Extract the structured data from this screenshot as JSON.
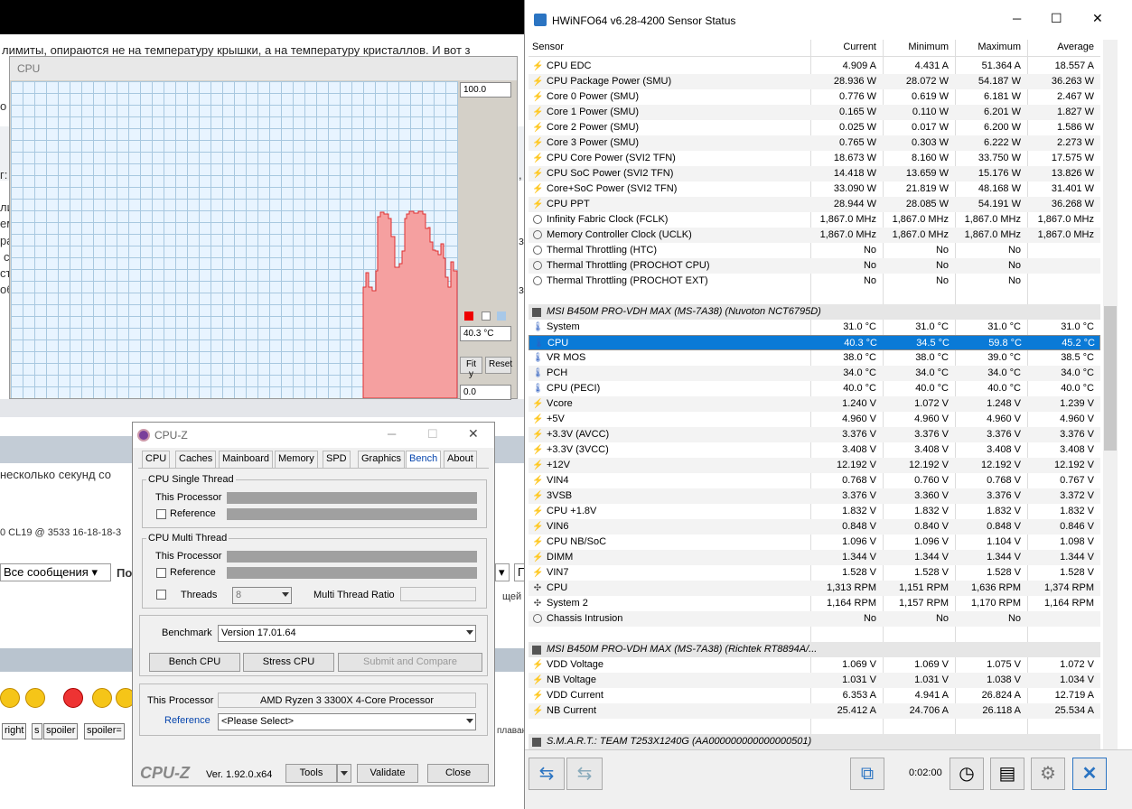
{
  "forum": {
    "line1": "лимиты, опираются не на температуру крышки, а на температуру кристаллов. И вот з",
    "line_few": "несколько секунд со",
    "line_cl": "0 CL19 @ 3533 16-18-18-3",
    "all_messages": "Все сообщения",
    "po": "По",
    "p": "П",
    "shchey": "щей",
    "slavo": "плаваю",
    "tags": [
      "right",
      "s",
      "spoiler",
      "spoiler="
    ],
    "left_fragments": [
      "о с",
      "г:",
      "лия",
      "ем",
      "ра",
      "с",
      "ст",
      "об"
    ],
    "right_fragments": [
      ",",
      "з",
      "з"
    ]
  },
  "graph": {
    "title": "CPU",
    "max": "100.0",
    "current": "40.3 °C",
    "min": "0.0",
    "fit_y": "Fit y",
    "reset": "Reset"
  },
  "cpuz": {
    "title": "CPU-Z",
    "tabs": [
      "CPU",
      "Caches",
      "Mainboard",
      "Memory",
      "SPD",
      "Graphics",
      "Bench",
      "About"
    ],
    "single_thread": "CPU Single Thread",
    "multi_thread": "CPU Multi Thread",
    "this_processor": "This Processor",
    "reference": "Reference",
    "threads": "Threads",
    "threads_value": "8",
    "multi_ratio": "Multi Thread Ratio",
    "benchmark_label": "Benchmark",
    "benchmark_version": "Version 17.01.64",
    "bench_cpu": "Bench CPU",
    "stress_cpu": "Stress CPU",
    "submit": "Submit and Compare",
    "this_processor2": "This Processor",
    "processor_name": "AMD Ryzen 3 3300X 4-Core Processor",
    "reference2": "Reference",
    "please_select": "<Please Select>",
    "logo": "CPU-Z",
    "version": "Ver. 1.92.0.x64",
    "tools": "Tools",
    "validate": "Validate",
    "close": "Close"
  },
  "hwinfo": {
    "title": "HWiNFO64 v6.28-4200 Sensor Status",
    "columns": [
      "Sensor",
      "Current",
      "Minimum",
      "Maximum",
      "Average"
    ],
    "rows1": [
      {
        "icon": "bolt",
        "name": "CPU EDC",
        "cur": "4.909 A",
        "min": "4.431 A",
        "max": "51.364 A",
        "avg": "18.557 A"
      },
      {
        "icon": "bolt",
        "name": "CPU Package Power (SMU)",
        "cur": "28.936 W",
        "min": "28.072 W",
        "max": "54.187 W",
        "avg": "36.263 W"
      },
      {
        "icon": "bolt",
        "name": "Core 0 Power (SMU)",
        "cur": "0.776 W",
        "min": "0.619 W",
        "max": "6.181 W",
        "avg": "2.467 W"
      },
      {
        "icon": "bolt",
        "name": "Core 1 Power (SMU)",
        "cur": "0.165 W",
        "min": "0.110 W",
        "max": "6.201 W",
        "avg": "1.827 W"
      },
      {
        "icon": "bolt",
        "name": "Core 2 Power (SMU)",
        "cur": "0.025 W",
        "min": "0.017 W",
        "max": "6.200 W",
        "avg": "1.586 W"
      },
      {
        "icon": "bolt",
        "name": "Core 3 Power (SMU)",
        "cur": "0.765 W",
        "min": "0.303 W",
        "max": "6.222 W",
        "avg": "2.273 W"
      },
      {
        "icon": "bolt",
        "name": "CPU Core Power (SVI2 TFN)",
        "cur": "18.673 W",
        "min": "8.160 W",
        "max": "33.750 W",
        "avg": "17.575 W"
      },
      {
        "icon": "bolt",
        "name": "CPU SoC Power (SVI2 TFN)",
        "cur": "14.418 W",
        "min": "13.659 W",
        "max": "15.176 W",
        "avg": "13.826 W"
      },
      {
        "icon": "bolt",
        "name": "Core+SoC Power (SVI2 TFN)",
        "cur": "33.090 W",
        "min": "21.819 W",
        "max": "48.168 W",
        "avg": "31.401 W"
      },
      {
        "icon": "bolt",
        "name": "CPU PPT",
        "cur": "28.944 W",
        "min": "28.085 W",
        "max": "54.191 W",
        "avg": "36.268 W"
      },
      {
        "icon": "clk",
        "name": "Infinity Fabric Clock (FCLK)",
        "cur": "1,867.0 MHz",
        "min": "1,867.0 MHz",
        "max": "1,867.0 MHz",
        "avg": "1,867.0 MHz"
      },
      {
        "icon": "clk",
        "name": "Memory Controller Clock (UCLK)",
        "cur": "1,867.0 MHz",
        "min": "1,867.0 MHz",
        "max": "1,867.0 MHz",
        "avg": "1,867.0 MHz"
      },
      {
        "icon": "clk",
        "name": "Thermal Throttling (HTC)",
        "cur": "No",
        "min": "No",
        "max": "No",
        "avg": ""
      },
      {
        "icon": "clk",
        "name": "Thermal Throttling (PROCHOT CPU)",
        "cur": "No",
        "min": "No",
        "max": "No",
        "avg": ""
      },
      {
        "icon": "clk",
        "name": "Thermal Throttling (PROCHOT EXT)",
        "cur": "No",
        "min": "No",
        "max": "No",
        "avg": ""
      }
    ],
    "group2": "MSI B450M PRO-VDH MAX (MS-7A38) (Nuvoton NCT6795D)",
    "rows2": [
      {
        "icon": "thm",
        "name": "System",
        "cur": "31.0 °C",
        "min": "31.0 °C",
        "max": "31.0 °C",
        "avg": "31.0 °C"
      },
      {
        "icon": "thm",
        "name": "CPU",
        "cur": "40.3 °C",
        "min": "34.5 °C",
        "max": "59.8 °C",
        "avg": "45.2 °C",
        "selected": true
      },
      {
        "icon": "thm",
        "name": "VR MOS",
        "cur": "38.0 °C",
        "min": "38.0 °C",
        "max": "39.0 °C",
        "avg": "38.5 °C"
      },
      {
        "icon": "thm",
        "name": "PCH",
        "cur": "34.0 °C",
        "min": "34.0 °C",
        "max": "34.0 °C",
        "avg": "34.0 °C"
      },
      {
        "icon": "thm",
        "name": "CPU (PECI)",
        "cur": "40.0 °C",
        "min": "40.0 °C",
        "max": "40.0 °C",
        "avg": "40.0 °C"
      },
      {
        "icon": "bolt",
        "name": "Vcore",
        "cur": "1.240 V",
        "min": "1.072 V",
        "max": "1.248 V",
        "avg": "1.239 V"
      },
      {
        "icon": "bolt",
        "name": "+5V",
        "cur": "4.960 V",
        "min": "4.960 V",
        "max": "4.960 V",
        "avg": "4.960 V"
      },
      {
        "icon": "bolt",
        "name": "+3.3V (AVCC)",
        "cur": "3.376 V",
        "min": "3.376 V",
        "max": "3.376 V",
        "avg": "3.376 V"
      },
      {
        "icon": "bolt",
        "name": "+3.3V (3VCC)",
        "cur": "3.408 V",
        "min": "3.408 V",
        "max": "3.408 V",
        "avg": "3.408 V"
      },
      {
        "icon": "bolt",
        "name": "+12V",
        "cur": "12.192 V",
        "min": "12.192 V",
        "max": "12.192 V",
        "avg": "12.192 V"
      },
      {
        "icon": "bolt",
        "name": "VIN4",
        "cur": "0.768 V",
        "min": "0.760 V",
        "max": "0.768 V",
        "avg": "0.767 V"
      },
      {
        "icon": "bolt",
        "name": "3VSB",
        "cur": "3.376 V",
        "min": "3.360 V",
        "max": "3.376 V",
        "avg": "3.372 V"
      },
      {
        "icon": "bolt",
        "name": "CPU +1.8V",
        "cur": "1.832 V",
        "min": "1.832 V",
        "max": "1.832 V",
        "avg": "1.832 V"
      },
      {
        "icon": "bolt",
        "name": "VIN6",
        "cur": "0.848 V",
        "min": "0.840 V",
        "max": "0.848 V",
        "avg": "0.846 V"
      },
      {
        "icon": "bolt",
        "name": "CPU NB/SoC",
        "cur": "1.096 V",
        "min": "1.096 V",
        "max": "1.104 V",
        "avg": "1.098 V"
      },
      {
        "icon": "bolt",
        "name": "DIMM",
        "cur": "1.344 V",
        "min": "1.344 V",
        "max": "1.344 V",
        "avg": "1.344 V"
      },
      {
        "icon": "bolt",
        "name": "VIN7",
        "cur": "1.528 V",
        "min": "1.528 V",
        "max": "1.528 V",
        "avg": "1.528 V"
      },
      {
        "icon": "fan",
        "name": "CPU",
        "cur": "1,313 RPM",
        "min": "1,151 RPM",
        "max": "1,636 RPM",
        "avg": "1,374 RPM"
      },
      {
        "icon": "fan",
        "name": "System 2",
        "cur": "1,164 RPM",
        "min": "1,157 RPM",
        "max": "1,170 RPM",
        "avg": "1,164 RPM"
      },
      {
        "icon": "clk",
        "name": "Chassis Intrusion",
        "cur": "No",
        "min": "No",
        "max": "No",
        "avg": ""
      }
    ],
    "group3": "MSI B450M PRO-VDH MAX (MS-7A38) (Richtek RT8894A/...",
    "rows3": [
      {
        "icon": "bolt",
        "name": "VDD Voltage",
        "cur": "1.069 V",
        "min": "1.069 V",
        "max": "1.075 V",
        "avg": "1.072 V"
      },
      {
        "icon": "bolt",
        "name": "NB Voltage",
        "cur": "1.031 V",
        "min": "1.031 V",
        "max": "1.038 V",
        "avg": "1.034 V"
      },
      {
        "icon": "bolt",
        "name": "VDD Current",
        "cur": "6.353 A",
        "min": "4.941 A",
        "max": "26.824 A",
        "avg": "12.719 A"
      },
      {
        "icon": "bolt",
        "name": "NB Current",
        "cur": "25.412 A",
        "min": "24.706 A",
        "max": "26.118 A",
        "avg": "25.534 A"
      }
    ],
    "group4": "S.M.A.R.T.: TEAM T253X1240G (AA000000000000000501)",
    "timer": "0:02:00",
    "minimize": "─",
    "maximize": "☐",
    "close": "✕"
  }
}
